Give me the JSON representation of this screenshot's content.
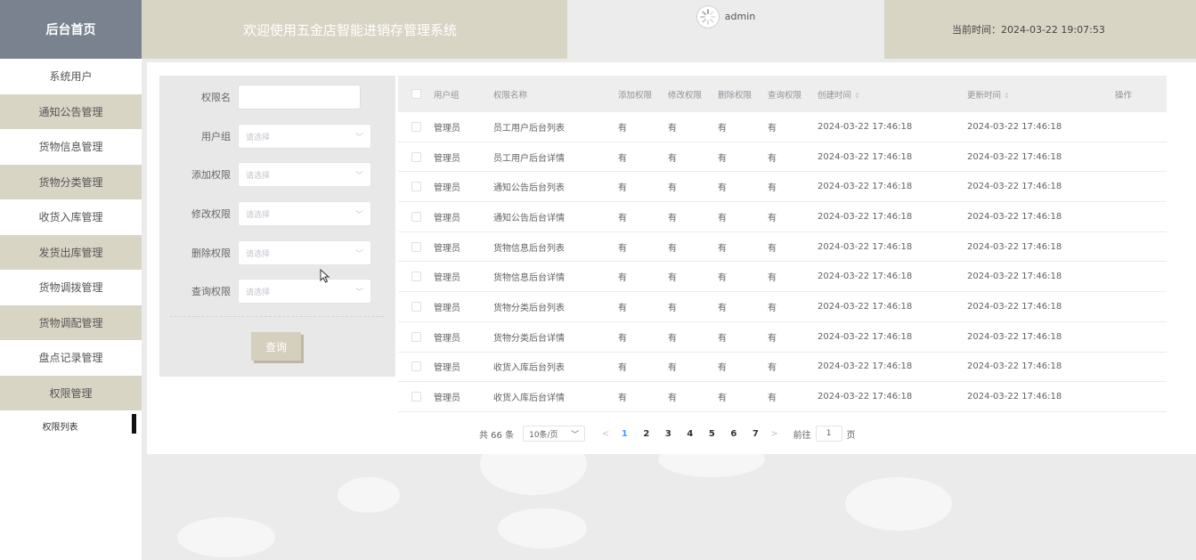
{
  "header": {
    "brand": "后台首页",
    "welcome": "欢迎使用五金店智能进销存管理系统",
    "username": "admin",
    "time_label": "当前时间：",
    "time_value": "2024-03-22 19:07:53"
  },
  "sidebar": {
    "items": [
      {
        "label": "系统用户"
      },
      {
        "label": "通知公告管理"
      },
      {
        "label": "货物信息管理"
      },
      {
        "label": "货物分类管理"
      },
      {
        "label": "收货入库管理"
      },
      {
        "label": "发货出库管理"
      },
      {
        "label": "货物调拨管理"
      },
      {
        "label": "货物调配管理"
      },
      {
        "label": "盘点记录管理"
      },
      {
        "label": "权限管理"
      }
    ],
    "sub_item": "权限列表"
  },
  "search": {
    "fields": [
      {
        "label": "权限名",
        "type": "input",
        "value": ""
      },
      {
        "label": "用户组",
        "type": "select",
        "placeholder": "请选择"
      },
      {
        "label": "添加权限",
        "type": "select",
        "placeholder": "请选择"
      },
      {
        "label": "修改权限",
        "type": "select",
        "placeholder": "请选择"
      },
      {
        "label": "删除权限",
        "type": "select",
        "placeholder": "请选择"
      },
      {
        "label": "查询权限",
        "type": "select",
        "placeholder": "请选择"
      }
    ],
    "button": "查询"
  },
  "table": {
    "headers": {
      "group": "用户组",
      "name": "权限名称",
      "add": "添加权限",
      "modify": "修改权限",
      "delete": "删除权限",
      "query": "查询权限",
      "created": "创建时间",
      "updated": "更新时间",
      "action": "操作"
    },
    "rows": [
      {
        "group": "管理员",
        "name": "员工用户后台列表",
        "add": "有",
        "modify": "有",
        "delete": "有",
        "query": "有",
        "created": "2024-03-22 17:46:18",
        "updated": "2024-03-22 17:46:18"
      },
      {
        "group": "管理员",
        "name": "员工用户后台详情",
        "add": "有",
        "modify": "有",
        "delete": "有",
        "query": "有",
        "created": "2024-03-22 17:46:18",
        "updated": "2024-03-22 17:46:18"
      },
      {
        "group": "管理员",
        "name": "通知公告后台列表",
        "add": "有",
        "modify": "有",
        "delete": "有",
        "query": "有",
        "created": "2024-03-22 17:46:18",
        "updated": "2024-03-22 17:46:18"
      },
      {
        "group": "管理员",
        "name": "通知公告后台详情",
        "add": "有",
        "modify": "有",
        "delete": "有",
        "query": "有",
        "created": "2024-03-22 17:46:18",
        "updated": "2024-03-22 17:46:18"
      },
      {
        "group": "管理员",
        "name": "货物信息后台列表",
        "add": "有",
        "modify": "有",
        "delete": "有",
        "query": "有",
        "created": "2024-03-22 17:46:18",
        "updated": "2024-03-22 17:46:18"
      },
      {
        "group": "管理员",
        "name": "货物信息后台详情",
        "add": "有",
        "modify": "有",
        "delete": "有",
        "query": "有",
        "created": "2024-03-22 17:46:18",
        "updated": "2024-03-22 17:46:18"
      },
      {
        "group": "管理员",
        "name": "货物分类后台列表",
        "add": "有",
        "modify": "有",
        "delete": "有",
        "query": "有",
        "created": "2024-03-22 17:46:18",
        "updated": "2024-03-22 17:46:18"
      },
      {
        "group": "管理员",
        "name": "货物分类后台详情",
        "add": "有",
        "modify": "有",
        "delete": "有",
        "query": "有",
        "created": "2024-03-22 17:46:18",
        "updated": "2024-03-22 17:46:18"
      },
      {
        "group": "管理员",
        "name": "收货入库后台列表",
        "add": "有",
        "modify": "有",
        "delete": "有",
        "query": "有",
        "created": "2024-03-22 17:46:18",
        "updated": "2024-03-22 17:46:18"
      },
      {
        "group": "管理员",
        "name": "收货入库后台详情",
        "add": "有",
        "modify": "有",
        "delete": "有",
        "query": "有",
        "created": "2024-03-22 17:46:18",
        "updated": "2024-03-22 17:46:18"
      }
    ]
  },
  "pagination": {
    "total": "共 66 条",
    "page_size": "10条/页",
    "prev": "<",
    "next": ">",
    "pages": [
      "1",
      "2",
      "3",
      "4",
      "5",
      "6",
      "7"
    ],
    "current_page": "1",
    "jump_label": "前往",
    "jump_value": "1",
    "jump_suffix": "页"
  },
  "colors": {
    "brand_bg": "#7a828f",
    "beige": "#d9d5c5",
    "active_page": "#409eff"
  },
  "icons": {
    "avatar": "avatar-icon",
    "select_arrow": "chevron-down-icon",
    "sort": "sort-icon",
    "cursor": "mouse-pointer-icon"
  }
}
